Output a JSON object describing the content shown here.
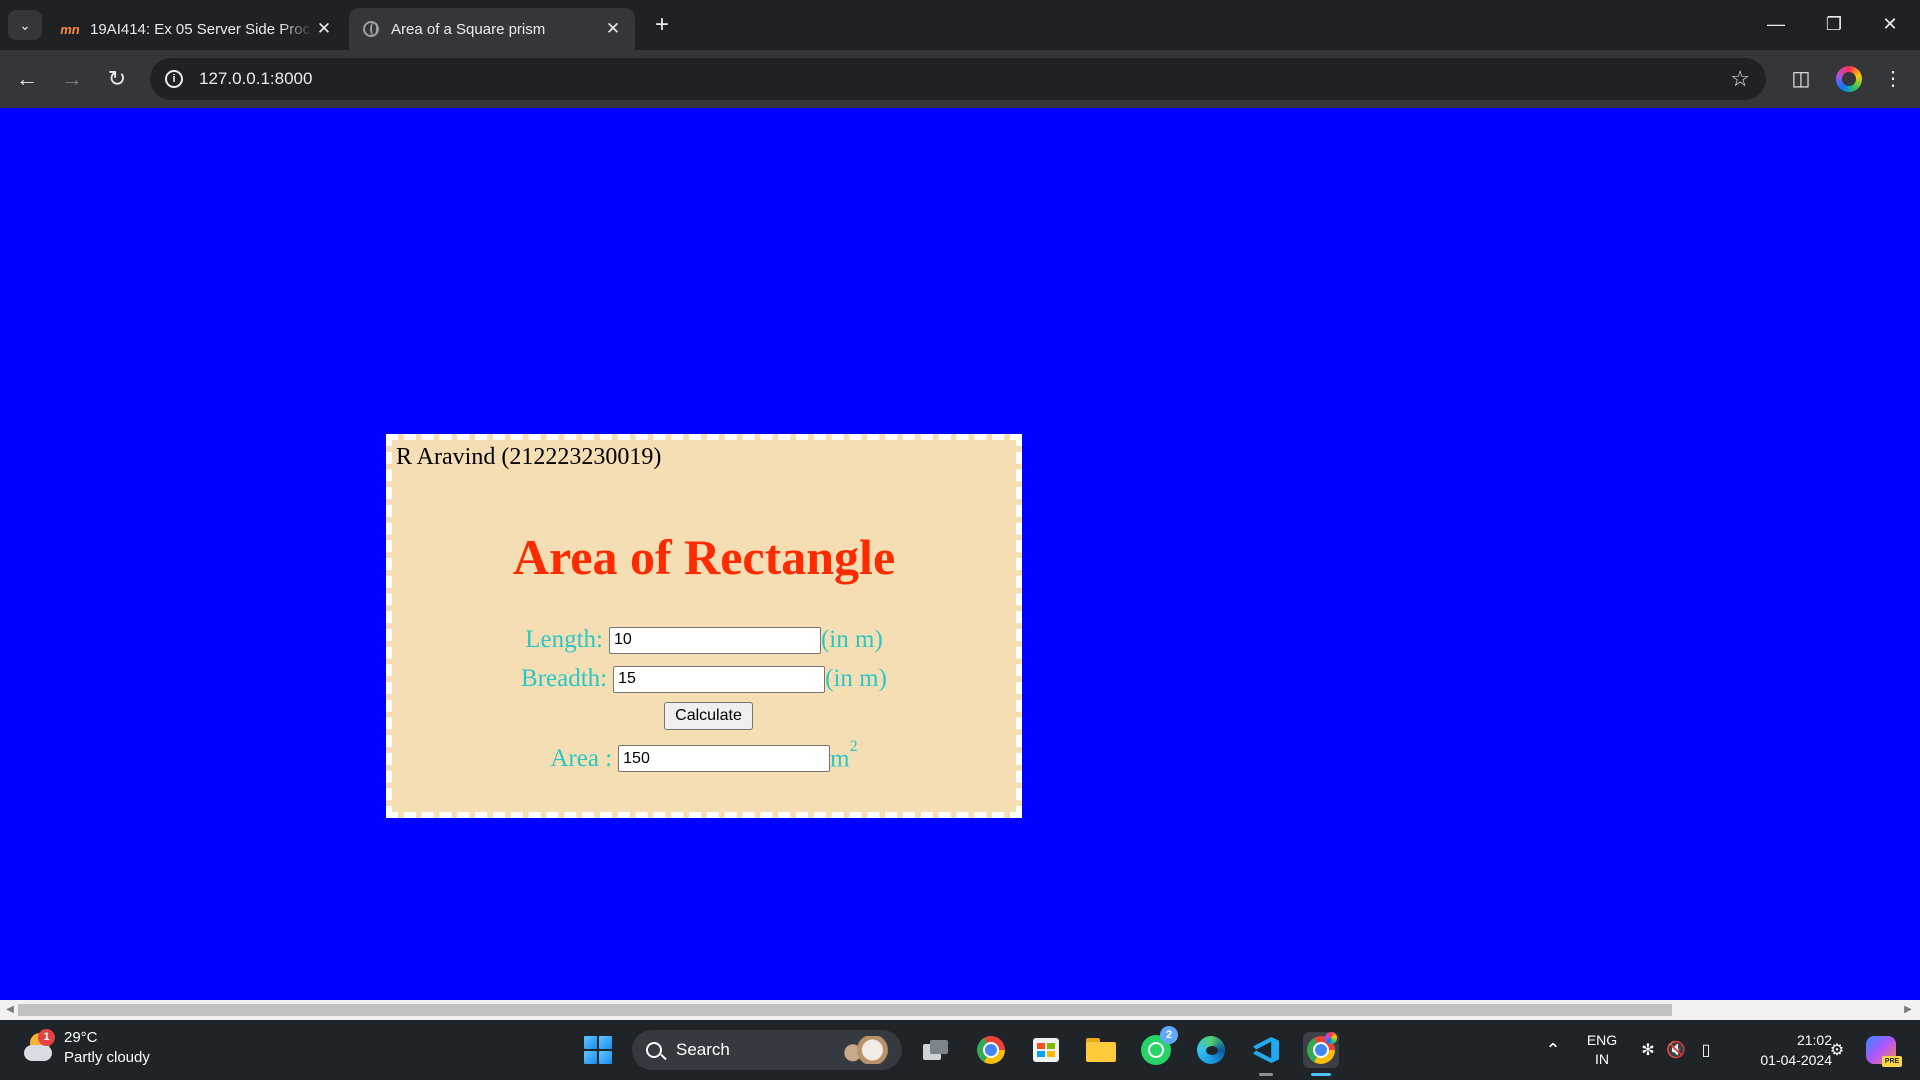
{
  "browser": {
    "tabs": [
      {
        "title": "19AI414: Ex 05 Server Side Proc",
        "favicon": "mn",
        "active": false
      },
      {
        "title": "Area of a Square prism",
        "favicon": "globe-icon",
        "active": true
      }
    ],
    "address": "127.0.0.1:8000"
  },
  "page": {
    "background_color": "#0000ff",
    "card_color": "#f5deb3",
    "heading_color": "#ff2a00",
    "label_color": "#29c7c7",
    "student": "R Aravind (212223230019)",
    "heading": "Area of Rectangle",
    "length": {
      "label": "Length:",
      "value": "10",
      "unit": "(in m)"
    },
    "breadth": {
      "label": "Breadth:",
      "value": "15",
      "unit": "(in m)"
    },
    "calculate_label": "Calculate",
    "area": {
      "label": "Area :",
      "value": "150",
      "unit": "m",
      "unit_exponent": "2"
    }
  },
  "taskbar": {
    "weather": {
      "temp": "29°C",
      "desc": "Partly cloudy",
      "badge": "1"
    },
    "search_label": "Search",
    "whatsapp_badge": "2",
    "lang_line1": "ENG",
    "lang_line2": "IN",
    "time": "21:02",
    "date": "01-04-2024",
    "copilot_tag": "PRE"
  }
}
